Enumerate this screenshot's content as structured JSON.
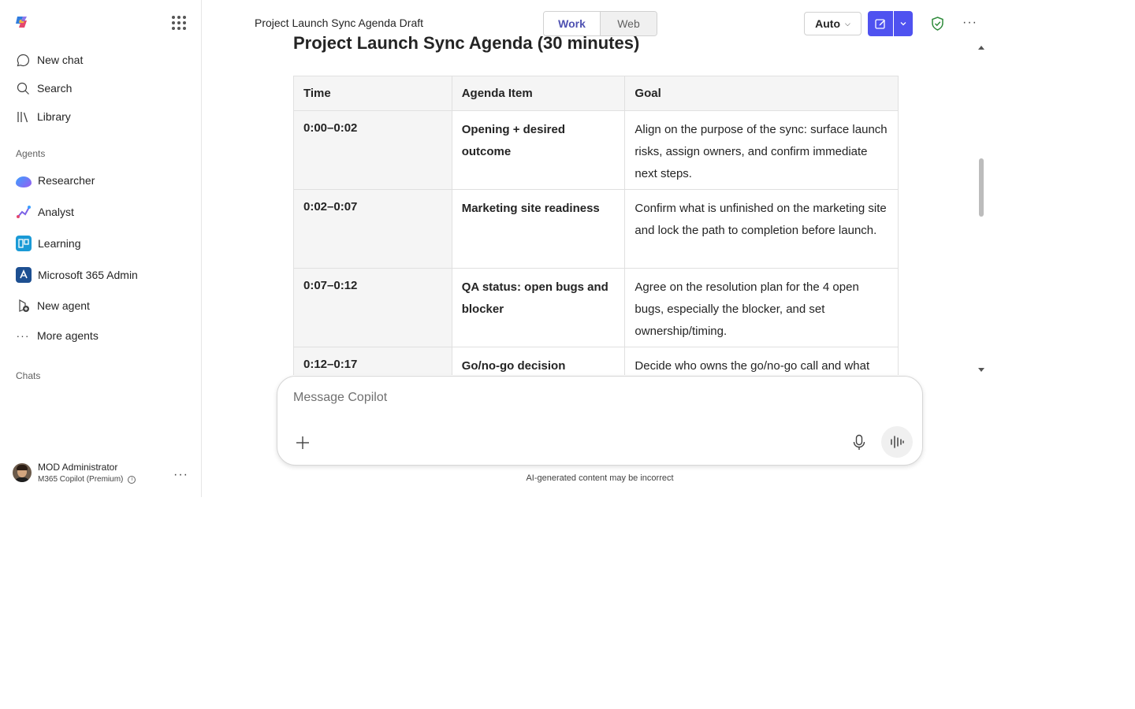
{
  "sidebar": {
    "nav": [
      {
        "label": "New chat",
        "icon": "chat-bubble-icon"
      },
      {
        "label": "Search",
        "icon": "search-icon"
      },
      {
        "label": "Library",
        "icon": "library-icon"
      }
    ],
    "agents_label": "Agents",
    "agents": [
      {
        "label": "Researcher",
        "icon": "researcher-icon"
      },
      {
        "label": "Analyst",
        "icon": "analyst-icon"
      },
      {
        "label": "Learning",
        "icon": "learning-icon"
      },
      {
        "label": "Microsoft 365 Admin",
        "icon": "admin-icon"
      },
      {
        "label": "New agent",
        "icon": "new-agent-icon"
      },
      {
        "label": "More agents",
        "icon": "more-icon"
      }
    ],
    "chats_label": "Chats",
    "profile": {
      "name": "MOD Administrator",
      "plan": "M365 Copilot (Premium)"
    }
  },
  "header": {
    "title": "Project Launch Sync Agenda Draft",
    "mode_tabs": [
      "Work",
      "Web"
    ],
    "active_mode": "Work",
    "model_select": "Auto"
  },
  "document": {
    "heading": "Project Launch Sync Agenda (30 minutes)",
    "columns": [
      "Time",
      "Agenda Item",
      "Goal"
    ],
    "rows": [
      {
        "time": "0:00–0:02",
        "item": "Opening + desired outcome",
        "goal": "Align on the purpose of the sync: surface launch risks, assign owners, and confirm immediate next steps."
      },
      {
        "time": "0:02–0:07",
        "item": "Marketing site readiness",
        "goal": "Confirm what is unfinished on the marketing site and lock the path to completion before launch."
      },
      {
        "time": "0:07–0:12",
        "item": "QA status: open bugs and blocker",
        "goal": "Agree on the resolution plan for the 4 open bugs, especially the blocker, and set ownership/timing."
      },
      {
        "time": "0:12–0:17",
        "item": "Go/no-go decision",
        "goal": "Decide who owns the go/no-go call and what"
      }
    ]
  },
  "composer": {
    "placeholder": "Message Copilot",
    "disclaimer": "AI-generated content may be incorrect"
  },
  "colors": {
    "accent": "#4f52f0",
    "accent_text": "#4f52b2",
    "shield": "#2e8b3a"
  }
}
